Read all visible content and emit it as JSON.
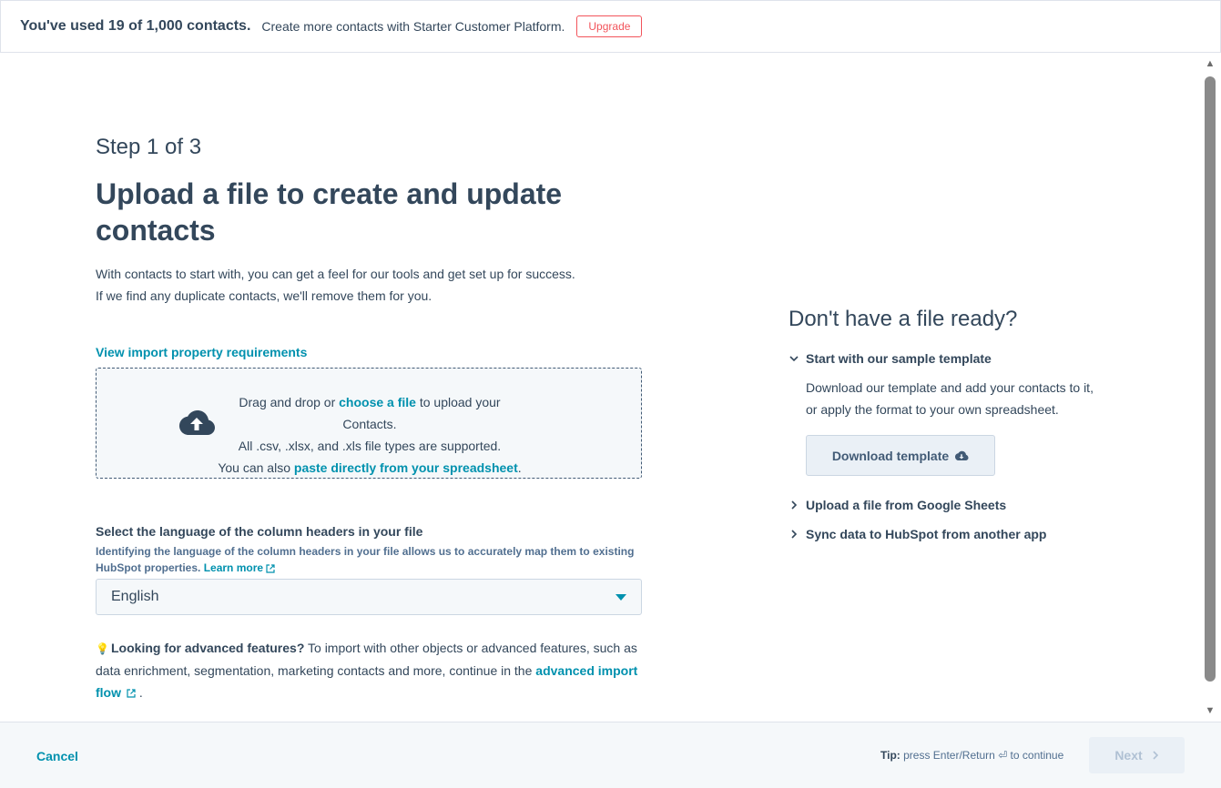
{
  "banner": {
    "usage": "You've used 19 of 1,000 contacts.",
    "message": "Create more contacts with Starter Customer Platform.",
    "upgrade_label": "Upgrade"
  },
  "main": {
    "step": "Step 1 of 3",
    "title": "Upload a file to create and update contacts",
    "description_line1": "With contacts to start with, you can get a feel for our tools and get set up for success.",
    "description_line2": "If we find any duplicate contacts, we'll remove them for you.",
    "requirements_link": "View import property requirements",
    "dropzone": {
      "line1_prefix": "Drag and drop or ",
      "line1_link": "choose a file",
      "line1_suffix": " to upload your Contacts.",
      "line2": "All .csv, .xlsx, and .xls file types are supported.",
      "line3_prefix": "You can also ",
      "line3_link": "paste directly from your spreadsheet",
      "line3_suffix": ".",
      "icon": "cloud-upload-icon"
    },
    "language": {
      "label": "Select the language of the column headers in your file",
      "help": "Identifying the language of the column headers in your file allows us to accurately map them to existing HubSpot properties.",
      "learn_more": "Learn more",
      "selected": "English"
    },
    "advanced": {
      "strong": "Looking for advanced features?",
      "text": " To import with other objects or advanced features, such as data enrichment, segmentation, marketing contacts and more, continue in the ",
      "link": "advanced import flow",
      "suffix": " ."
    }
  },
  "sidebar": {
    "title": "Don't have a file ready?",
    "items": [
      {
        "label": "Start with our sample template",
        "expanded": true
      },
      {
        "label": "Upload a file from Google Sheets",
        "expanded": false
      },
      {
        "label": "Sync data to HubSpot from another app",
        "expanded": false
      }
    ],
    "template_body": "Download our template and add your contacts to it, or apply the format to your own spreadsheet.",
    "download_label": "Download template"
  },
  "footer": {
    "cancel_label": "Cancel",
    "tip_label": "Tip:",
    "tip_text": " press Enter/Return ⏎ to continue",
    "next_label": "Next"
  },
  "colors": {
    "text": "#33475b",
    "link": "#0091ae",
    "upgrade": "#f2545b",
    "footer_bg": "#f5f8fa"
  }
}
